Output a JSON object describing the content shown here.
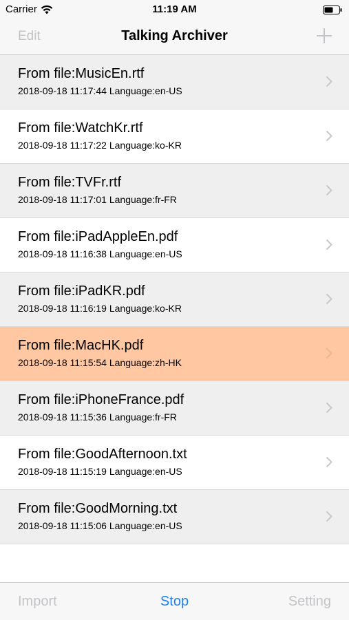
{
  "status_bar": {
    "carrier": "Carrier",
    "time": "11:19 AM",
    "icons": [
      "wifi-icon",
      "battery-icon"
    ]
  },
  "nav_bar": {
    "edit_label": "Edit",
    "title": "Talking Archiver",
    "add_icon": "plus-icon"
  },
  "list": {
    "items": [
      {
        "title": "From file:MusicEn.rtf",
        "subtitle": "2018-09-18 11:17:44 Language:en-US"
      },
      {
        "title": "From file:WatchKr.rtf",
        "subtitle": "2018-09-18 11:17:22 Language:ko-KR"
      },
      {
        "title": "From file:TVFr.rtf",
        "subtitle": "2018-09-18 11:17:01 Language:fr-FR"
      },
      {
        "title": "From file:iPadAppleEn.pdf",
        "subtitle": "2018-09-18 11:16:38 Language:en-US"
      },
      {
        "title": "From file:iPadKR.pdf",
        "subtitle": "2018-09-18 11:16:19 Language:ko-KR"
      },
      {
        "title": "From file:MacHK.pdf",
        "subtitle": "2018-09-18 11:15:54 Language:zh-HK",
        "selected": true
      },
      {
        "title": "From file:iPhoneFrance.pdf",
        "subtitle": "2018-09-18 11:15:36 Language:fr-FR"
      },
      {
        "title": "From file:GoodAfternoon.txt",
        "subtitle": "2018-09-18 11:15:19 Language:en-US"
      },
      {
        "title": "From file:GoodMorning.txt",
        "subtitle": "2018-09-18 11:15:06 Language:en-US"
      }
    ]
  },
  "tab_bar": {
    "import_label": "Import",
    "stop_label": "Stop",
    "setting_label": "Setting"
  },
  "colors": {
    "accent": "#1b82f5",
    "disabled": "#c4c4c8",
    "selected_row": "#ffc8a3",
    "alt_row": "#efefef",
    "chevron": "#c7c7cc"
  }
}
